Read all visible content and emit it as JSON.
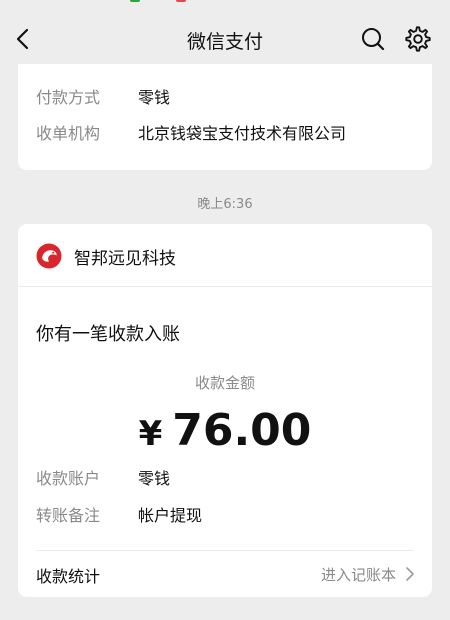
{
  "nav": {
    "title": "微信支付"
  },
  "payment_card": {
    "rows": [
      {
        "label": "付款方式",
        "value": "零钱"
      },
      {
        "label": "收单机构",
        "value": "北京钱袋宝支付技术有限公司"
      }
    ]
  },
  "timestamp": "晚上6:36",
  "receipt": {
    "merchant": "智邦远见科技",
    "headline": "你有一笔收款入账",
    "amount_label": "收款金额",
    "currency": "¥",
    "amount": "76.00",
    "rows": [
      {
        "label": "收款账户",
        "value": "零钱"
      },
      {
        "label": "转账备注",
        "value": "帐户提现"
      }
    ],
    "stats_label": "收款统计",
    "stats_link": "进入记账本"
  },
  "icons": {
    "back": "back-arrow-icon",
    "search": "search-icon",
    "settings": "gear-icon",
    "merchant_logo": "merchant-logo-icon",
    "chevron": "chevron-right-icon"
  },
  "colors": {
    "background": "#ededed",
    "card": "#ffffff",
    "label_gray": "#8a8a8a",
    "logo_red": "#d9262c"
  }
}
